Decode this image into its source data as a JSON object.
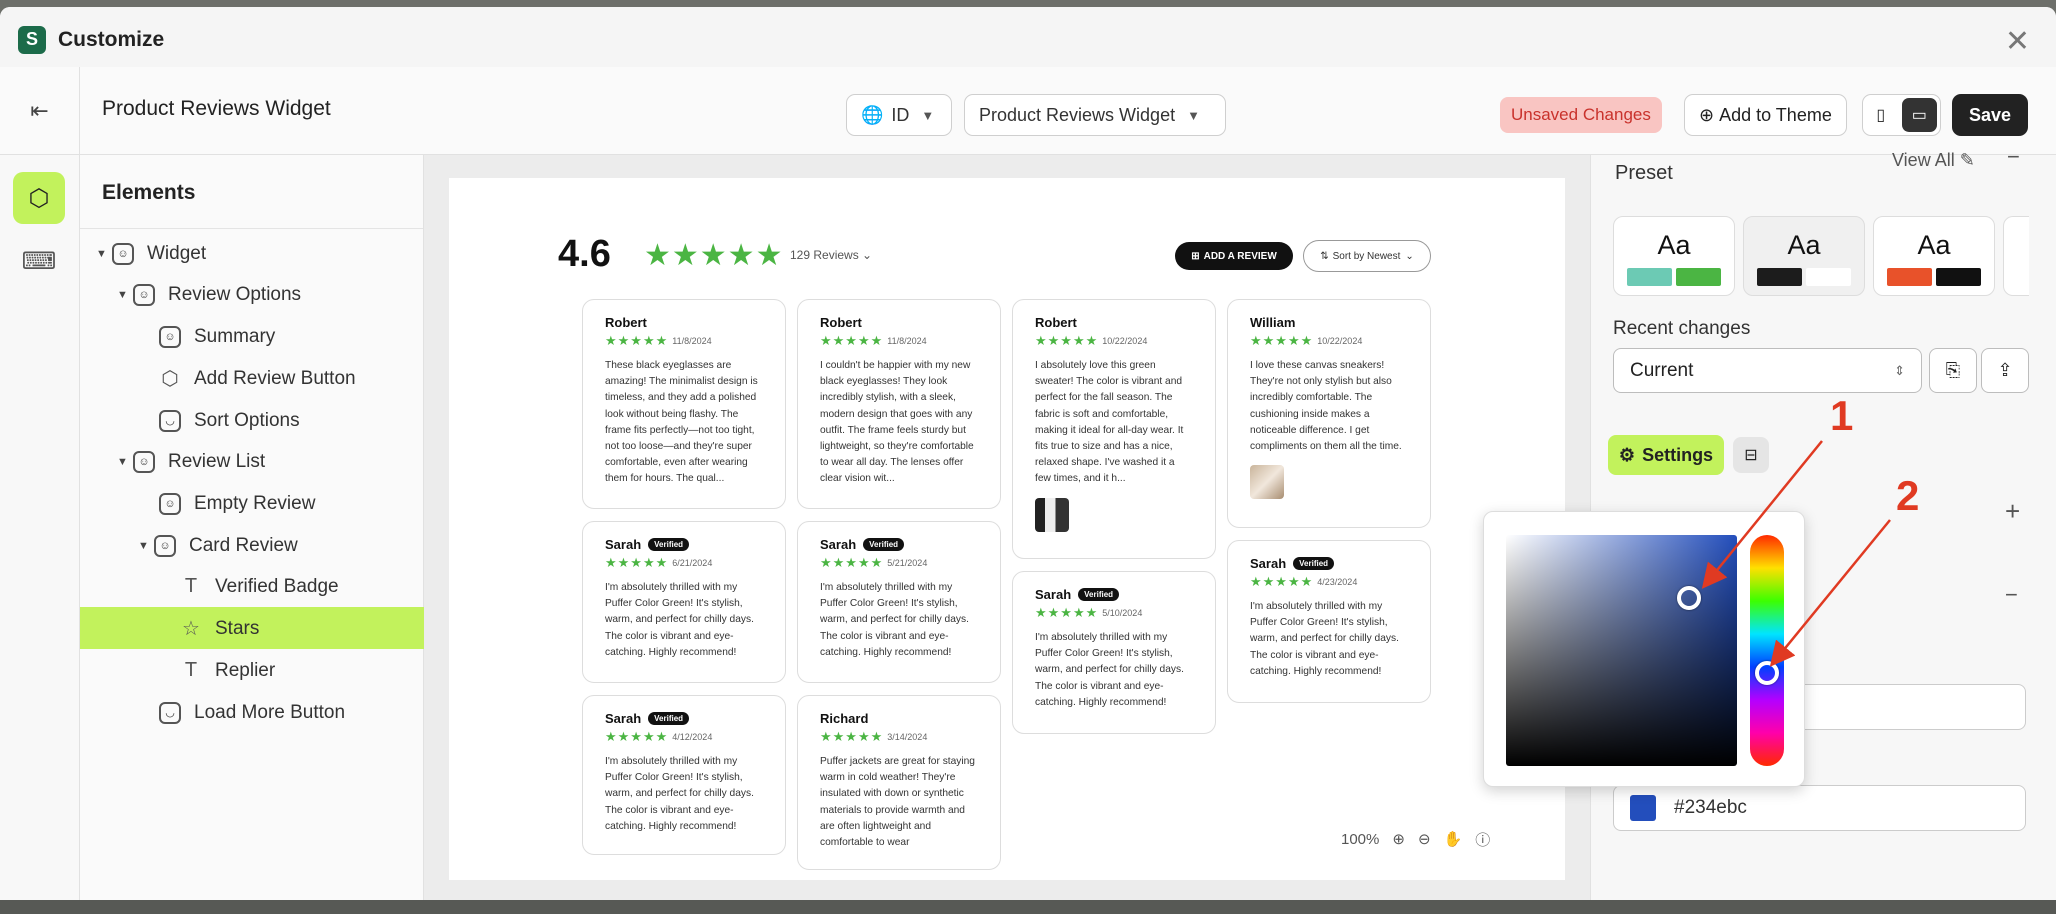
{
  "app": {
    "title": "Customize"
  },
  "topbar": {
    "page_title": "Product Reviews Widget",
    "language": "ID",
    "template": "Product Reviews Widget",
    "unsaved": "Unsaved Changes",
    "add_to_theme": "Add to Theme",
    "save": "Save"
  },
  "elements": {
    "heading": "Elements",
    "tree": [
      {
        "label": "Widget"
      },
      {
        "label": "Review Options"
      },
      {
        "label": "Summary"
      },
      {
        "label": "Add Review Button"
      },
      {
        "label": "Sort Options"
      },
      {
        "label": "Review List"
      },
      {
        "label": "Empty Review"
      },
      {
        "label": "Card Review"
      },
      {
        "label": "Verified Badge"
      },
      {
        "label": "Stars"
      },
      {
        "label": "Replier"
      },
      {
        "label": "Load More Button"
      }
    ],
    "selected": "Stars"
  },
  "widget": {
    "rating": "4.6",
    "stars": "★★★★★",
    "review_count": "129 Reviews",
    "add_review": "ADD A REVIEW",
    "sort": "Sort by Newest",
    "verified": "Verified",
    "reviews": [
      {
        "name": "Robert",
        "date": "11/8/2024",
        "text": "These black eyeglasses are amazing! The minimalist design is timeless, and they add a polished look without being flashy. The frame fits perfectly—not too tight, not too loose—and they're super comfortable, even after wearing them for hours. The qual..."
      },
      {
        "name": "Robert",
        "date": "11/8/2024",
        "text": "I couldn't be happier with my new black eyeglasses! They look incredibly stylish, with a sleek, modern design that goes with any outfit. The frame feels sturdy but lightweight, so they're comfortable to wear all day. The lenses offer clear vision wit..."
      },
      {
        "name": "Robert",
        "date": "10/22/2024",
        "text": "I absolutely love this green sweater! The color is vibrant and perfect for the fall season. The fabric is soft and comfortable, making it ideal for all-day wear. It fits true to size and has a nice, relaxed shape. I've washed it a few times, and it h..."
      },
      {
        "name": "William",
        "date": "10/22/2024",
        "text": "I love these canvas sneakers! They're not only stylish but also incredibly comfortable. The cushioning inside makes a noticeable difference. I get compliments on them all the time."
      },
      {
        "name": "Sarah",
        "date": "6/21/2024",
        "text": "I'm absolutely thrilled with my Puffer Color Green! It's stylish, warm, and perfect for chilly days. The color is vibrant and eye-catching. Highly recommend!"
      },
      {
        "name": "Sarah",
        "date": "5/21/2024",
        "text": "I'm absolutely thrilled with my Puffer Color Green! It's stylish, warm, and perfect for chilly days. The color is vibrant and eye-catching. Highly recommend!"
      },
      {
        "name": "Sarah",
        "date": "5/10/2024",
        "text": "I'm absolutely thrilled with my Puffer Color Green! It's stylish, warm, and perfect for chilly days. The color is vibrant and eye-catching. Highly recommend!"
      },
      {
        "name": "Sarah",
        "date": "4/23/2024",
        "text": "I'm absolutely thrilled with my Puffer Color Green! It's stylish, warm, and perfect for chilly days. The color is vibrant and eye-catching. Highly recommend!"
      },
      {
        "name": "Sarah",
        "date": "4/12/2024",
        "text": "I'm absolutely thrilled with my Puffer Color Green! It's stylish, warm, and perfect for chilly days. The color is vibrant and eye-catching. Highly recommend!"
      },
      {
        "name": "Richard",
        "date": "3/14/2024",
        "text": "Puffer jackets are great for staying warm in cold weather! They're insulated with down or synthetic materials to provide warmth and are often lightweight and comfortable to wear"
      }
    ]
  },
  "zoom": {
    "level": "100%"
  },
  "panel": {
    "preset_heading": "Preset",
    "view_all": "View All",
    "preset_sample": "Aa",
    "recent_changes": "Recent changes",
    "current": "Current",
    "settings": "Settings",
    "color_value": "#234ebc"
  },
  "annotations": {
    "one": "1",
    "two": "2"
  },
  "colors": {
    "accent": "#c2f25c",
    "star": "#4bb543",
    "picked": "#234ebc",
    "annotation": "#e03a22"
  }
}
